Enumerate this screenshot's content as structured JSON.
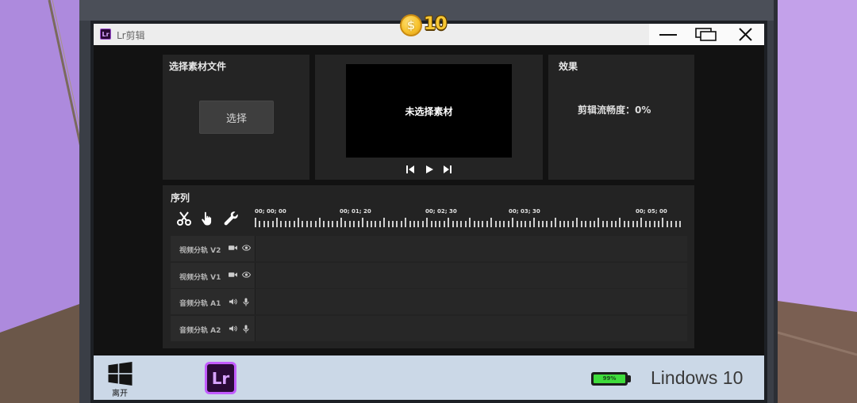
{
  "hud": {
    "coin_symbol": "$",
    "coins": "10"
  },
  "window": {
    "app_icon_text": "Lr",
    "title": "Lr剪辑",
    "controls": [
      "minimize-icon",
      "maximize-icon",
      "close-icon"
    ]
  },
  "panels": {
    "source": {
      "title": "选择素材文件",
      "select_button": "选择"
    },
    "preview": {
      "placeholder": "未选择素材",
      "controls": [
        "skip-back-icon",
        "play-icon",
        "skip-forward-icon"
      ]
    },
    "effects": {
      "title": "效果",
      "smoothness": "剪辑流畅度：0%"
    }
  },
  "sequence": {
    "title": "序列",
    "tools": [
      "scissors-icon",
      "hand-pointer-icon",
      "wrench-icon"
    ],
    "timecodes": [
      "00; 00; 00",
      "00; 01; 20",
      "00; 02; 30",
      "00; 03; 30",
      "00; 05; 00"
    ],
    "tracks": [
      {
        "label": "视频分轨 V2",
        "icons": [
          "video-camera-icon",
          "eye-icon"
        ]
      },
      {
        "label": "视频分轨 V1",
        "icons": [
          "video-camera-icon",
          "eye-icon"
        ]
      },
      {
        "label": "音频分轨 A1",
        "icons": [
          "speaker-icon",
          "microphone-icon"
        ]
      },
      {
        "label": "音频分轨 A2",
        "icons": [
          "speaker-icon",
          "microphone-icon"
        ]
      }
    ]
  },
  "taskbar": {
    "start_label": "离开",
    "app_icon_text": "Lr",
    "battery": {
      "label": "99%",
      "level": 0.99
    },
    "os_name": "Lindows 10"
  },
  "colors": {
    "lr_purple": "#c25cff",
    "battery_green": "#3fdc3c",
    "coin_gold": "#f7c22c",
    "taskbar": "#cbd8e7"
  }
}
